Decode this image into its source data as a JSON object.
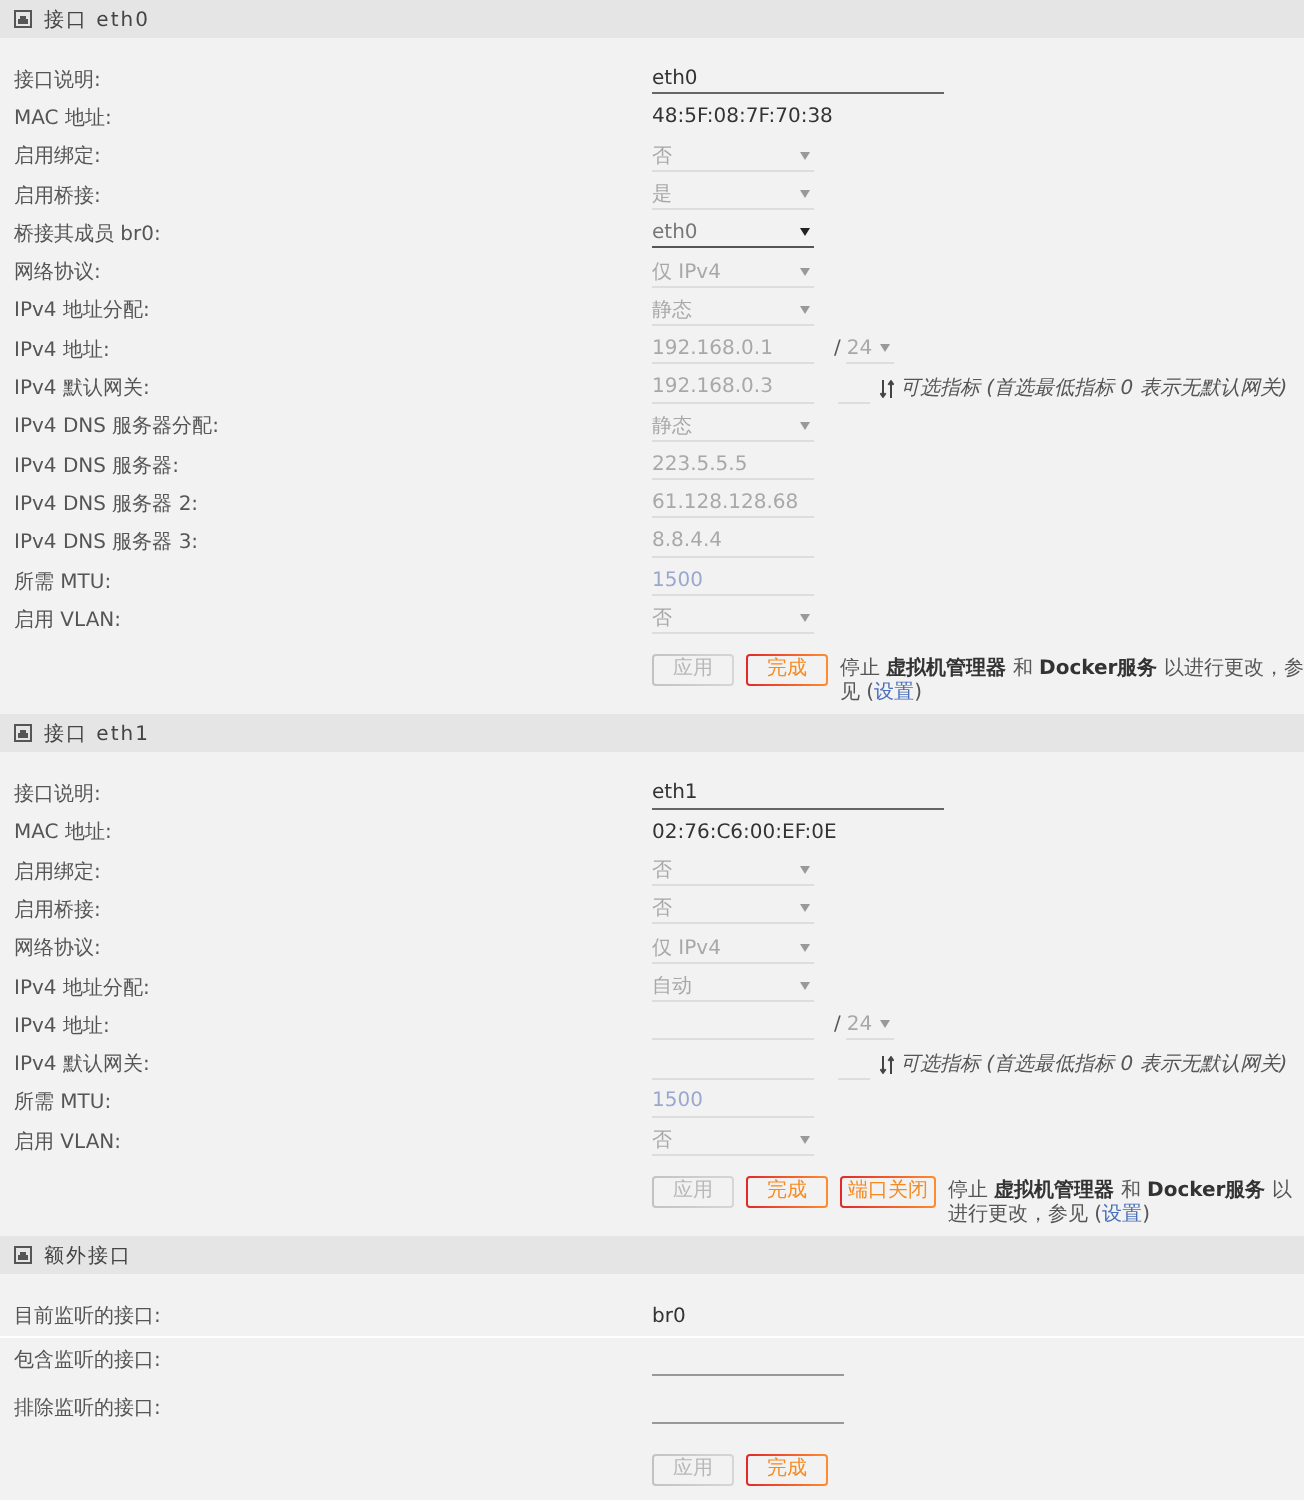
{
  "sections": [
    {
      "kind": "interface",
      "title": "接口 eth0",
      "rows": [
        {
          "kind": "wide",
          "label": "接口说明:",
          "value": "eth0",
          "disabled": false
        },
        {
          "kind": "text",
          "label": "MAC 地址:",
          "value": "48:5F:08:7F:70:38"
        },
        {
          "kind": "select",
          "label": "启用绑定:",
          "value": "否",
          "disabled": true
        },
        {
          "kind": "select",
          "label": "启用桥接:",
          "value": "是",
          "disabled": true
        },
        {
          "kind": "select",
          "label": "桥接其成员 br0:",
          "value": "eth0",
          "disabled": false
        },
        {
          "kind": "select",
          "label": "网络协议:",
          "value": "仅 IPv4",
          "disabled": true
        },
        {
          "kind": "select",
          "label": "IPv4 地址分配:",
          "value": "静态",
          "disabled": true
        },
        {
          "kind": "address",
          "label": "IPv4 地址:",
          "value": "192.168.0.1",
          "separator": "/",
          "prefix": "24",
          "disabled": true
        },
        {
          "kind": "gateway",
          "label": "IPv4 默认网关:",
          "value": "192.168.0.3",
          "hint": "可选指标 (首选最低指标 0 表示无默认网关)",
          "disabled": true
        },
        {
          "kind": "select",
          "label": "IPv4 DNS 服务器分配:",
          "value": "静态",
          "disabled": true
        },
        {
          "kind": "field",
          "label": "IPv4 DNS 服务器:",
          "value": "223.5.5.5",
          "disabled": true
        },
        {
          "kind": "field",
          "label": "IPv4 DNS 服务器 2:",
          "value": "61.128.128.68",
          "disabled": true
        },
        {
          "kind": "field",
          "label": "IPv4 DNS 服务器 3:",
          "value": "8.8.4.4",
          "disabled": true
        },
        {
          "kind": "field",
          "label": "所需 MTU:",
          "placeholder": "1500",
          "disabled": true
        },
        {
          "kind": "select",
          "label": "启用 VLAN:",
          "value": "否",
          "disabled": true
        }
      ],
      "buttons": [
        {
          "label": "应用",
          "disabled": true
        },
        {
          "label": "完成",
          "disabled": false
        }
      ],
      "note": {
        "text": "停止 **虚拟机管理器** 和 **Docker服务** 以进行更改，参见 (",
        "link": "设置",
        "closing": ")"
      }
    },
    {
      "kind": "interface",
      "title": "接口 eth1",
      "rows": [
        {
          "kind": "wide",
          "label": "接口说明:",
          "value": "eth1",
          "disabled": false
        },
        {
          "kind": "text",
          "label": "MAC 地址:",
          "value": "02:76:C6:00:EF:0E"
        },
        {
          "kind": "select",
          "label": "启用绑定:",
          "value": "否",
          "disabled": true
        },
        {
          "kind": "select",
          "label": "启用桥接:",
          "value": "否",
          "disabled": true
        },
        {
          "kind": "select",
          "label": "网络协议:",
          "value": "仅 IPv4",
          "disabled": true
        },
        {
          "kind": "select",
          "label": "IPv4 地址分配:",
          "value": "自动",
          "disabled": true
        },
        {
          "kind": "address",
          "label": "IPv4 地址:",
          "separator": "/",
          "prefix": "24",
          "disabled": true
        },
        {
          "kind": "gateway",
          "label": "IPv4 默认网关:",
          "hint": "可选指标 (首选最低指标 0 表示无默认网关)",
          "disabled": true
        },
        {
          "kind": "field",
          "label": "所需 MTU:",
          "placeholder": "1500",
          "disabled": true
        },
        {
          "kind": "select",
          "label": "启用 VLAN:",
          "value": "否",
          "disabled": true
        }
      ],
      "buttons": [
        {
          "label": "应用",
          "disabled": true
        },
        {
          "label": "完成",
          "disabled": false
        },
        {
          "label": "端口关闭",
          "disabled": false
        }
      ],
      "note": {
        "text": "停止 **虚拟机管理器** 和 **Docker服务** 以进行更改，参见 (",
        "link": "设置",
        "closing": ")"
      }
    },
    {
      "kind": "extra",
      "title": "额外接口",
      "rows": [
        {
          "kind": "text",
          "label": "目前监听的接口:",
          "value": "br0"
        },
        {
          "kind": "field",
          "label": "包含监听的接口:",
          "disabled": false
        },
        {
          "kind": "field",
          "label": "排除监听的接口:",
          "disabled": false
        }
      ],
      "buttons": [
        {
          "label": "应用",
          "disabled": true
        },
        {
          "label": "完成",
          "disabled": false
        }
      ]
    }
  ]
}
